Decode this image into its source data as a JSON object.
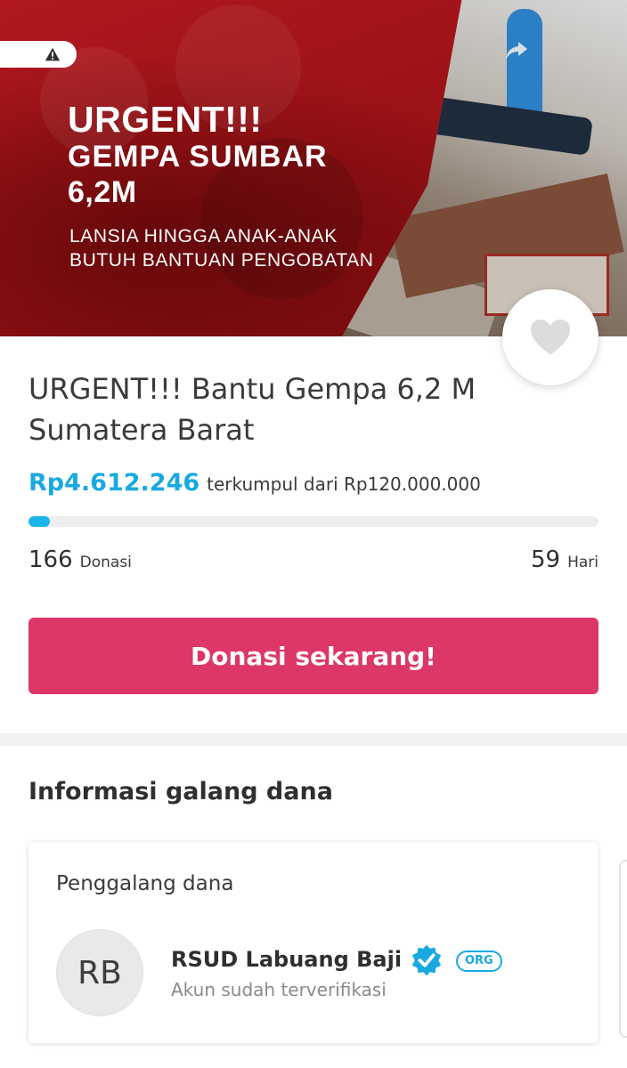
{
  "banner": {
    "headline_line1": "URGENT!!!",
    "headline_line2": "GEMPA SUMBAR",
    "headline_line3": "6,2M",
    "sub_line1": "LANSIA HINGGA ANAK-ANAK",
    "sub_line2": "BUTUH BANTUAN PENGOBATAN",
    "icons": {
      "pill": "warning-icon",
      "share": "share-arrow-icon",
      "favorite": "heart-icon"
    }
  },
  "campaign": {
    "title": "URGENT!!! Bantu Gempa 6,2 M Sumatera Barat",
    "collected_amount": "Rp4.612.246",
    "collected_text": "terkumpul dari Rp120.000.000",
    "progress_percent": 3.8,
    "donations_count": "166",
    "donations_label": "Donasi",
    "days_count": "59",
    "days_label": "Hari",
    "donate_button_label": "Donasi sekarang!"
  },
  "fundraiser_section": {
    "title": "Informasi galang dana",
    "card_label": "Penggalang dana",
    "avatar_initials": "RB",
    "org_name": "RSUD Labuang Baji",
    "badge": "ORG",
    "verified_text": "Akun sudah terverifikasi"
  },
  "colors": {
    "accent_blue": "#19a9e1",
    "donate_pink": "#dc3767",
    "banner_red": "#a3141a"
  }
}
